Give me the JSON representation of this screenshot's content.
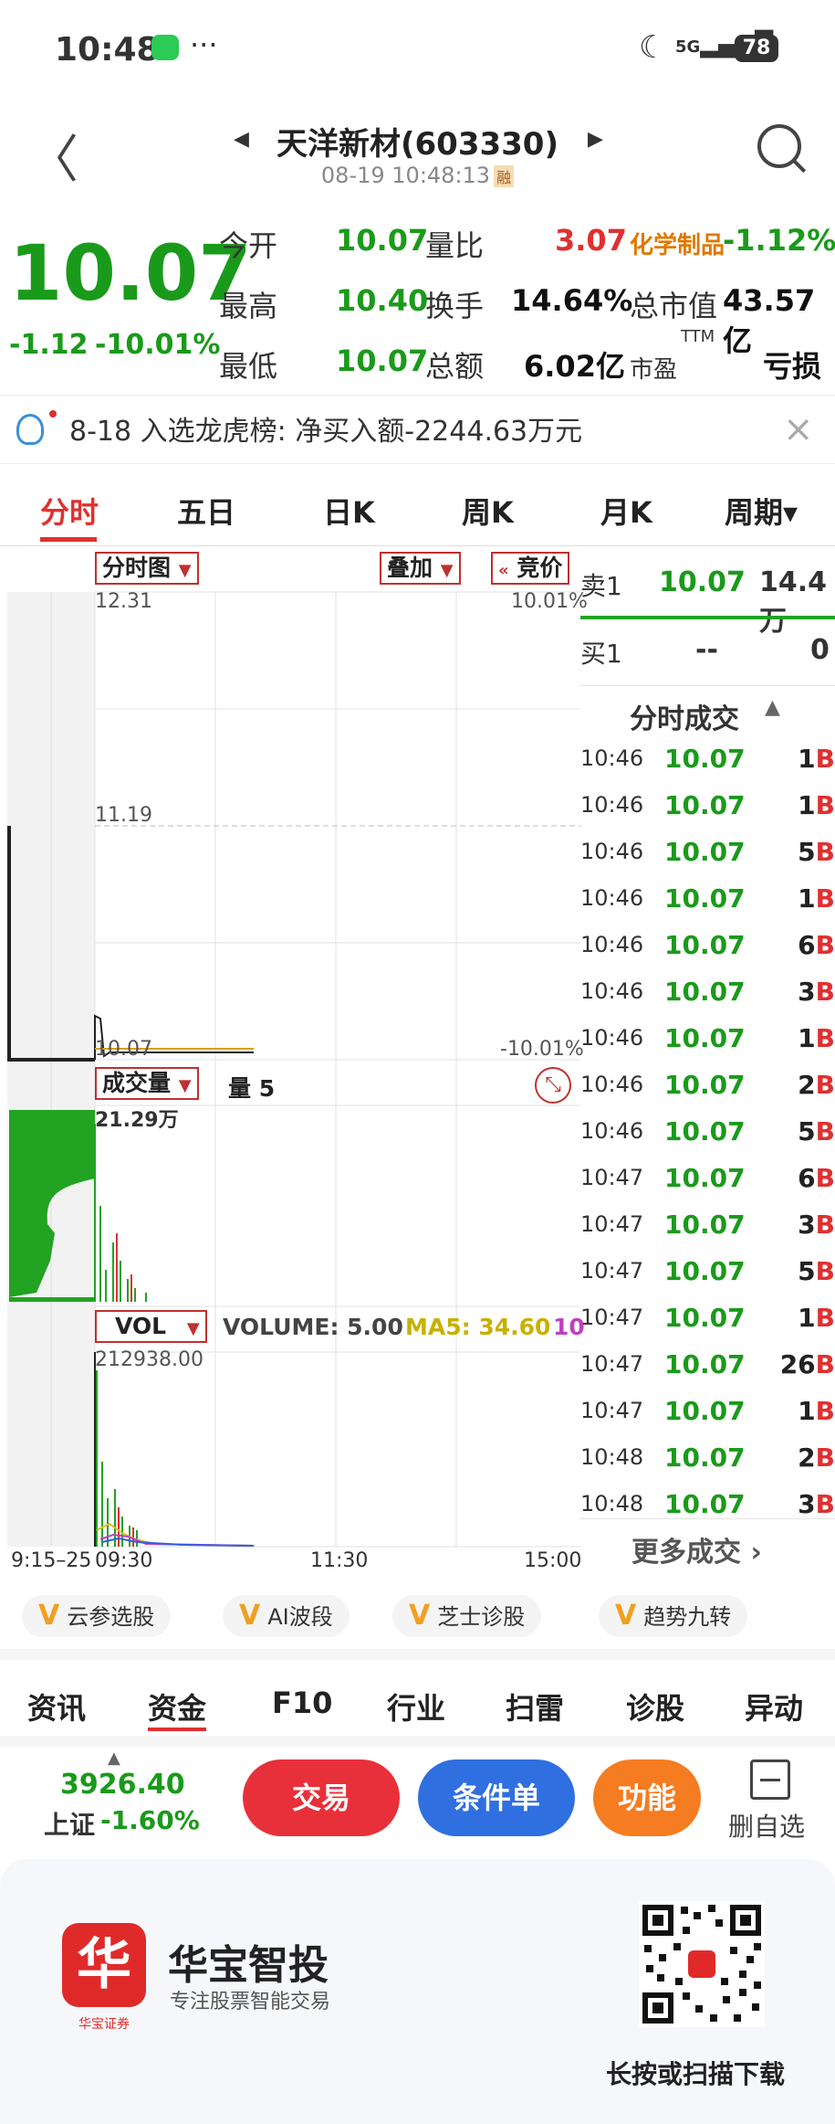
{
  "status": {
    "time": "10:48",
    "dots": "···",
    "signal": "5G",
    "battery": "78"
  },
  "header": {
    "title": "天洋新材(603330)",
    "subtitle": "08-19 10:48:13",
    "badge": "融"
  },
  "quote": {
    "price": "10.07",
    "change": "-1.12",
    "change_pct": "-10.01%",
    "open_label": "今开",
    "open": "10.07",
    "vol_ratio_label": "量比",
    "vol_ratio": "3.07",
    "sector": "化学制品",
    "sector_pct": "-1.12%",
    "high_label": "最高",
    "high": "10.40",
    "turnover_label": "换手",
    "turnover": "14.64%",
    "mcap_label": "总市值",
    "mcap": "43.57亿",
    "low_label": "最低",
    "low": "10.07",
    "amount_label": "总额",
    "amount": "6.02亿",
    "pe_label": "市盈",
    "pe_sup": "TTM",
    "pe": "亏损"
  },
  "notice": {
    "text": "8-18 入选龙虎榜: 净买入额-2244.63万元",
    "close": "×"
  },
  "tabs": [
    "分时",
    "五日",
    "日K",
    "周K",
    "月K",
    "周期▾"
  ],
  "chart": {
    "ctl_chart": "分时图",
    "ctl_overlay": "叠加",
    "ctl_auction": "竞价",
    "top_price": "12.31",
    "top_pct": "10.01%",
    "mid_price": "11.19",
    "low_price": "10.07",
    "low_pct": "-10.01%",
    "vol_ctl": "成交量",
    "vol_label": "量 5",
    "vol_max": "21.29万",
    "ind_ctl": "VOL",
    "ind_volume": "VOLUME: 5.00",
    "ind_ma5": "MA5: 34.60",
    "ind_ma10": "10",
    "ind_max": "212938.00",
    "x_labels": [
      "9:15–25",
      "09:30",
      "11:30",
      "15:00"
    ]
  },
  "book": {
    "sell1_label": "卖1",
    "sell1_price": "10.07",
    "sell1_vol": "14.4万",
    "buy1_label": "买1",
    "buy1_price": "--",
    "buy1_vol": "0",
    "trades_title": "分时成交",
    "trades": [
      [
        "10:46",
        "10.07",
        "1"
      ],
      [
        "10:46",
        "10.07",
        "1"
      ],
      [
        "10:46",
        "10.07",
        "5"
      ],
      [
        "10:46",
        "10.07",
        "1"
      ],
      [
        "10:46",
        "10.07",
        "6"
      ],
      [
        "10:46",
        "10.07",
        "3"
      ],
      [
        "10:46",
        "10.07",
        "1"
      ],
      [
        "10:46",
        "10.07",
        "2"
      ],
      [
        "10:46",
        "10.07",
        "5"
      ],
      [
        "10:47",
        "10.07",
        "6"
      ],
      [
        "10:47",
        "10.07",
        "3"
      ],
      [
        "10:47",
        "10.07",
        "5"
      ],
      [
        "10:47",
        "10.07",
        "1"
      ],
      [
        "10:47",
        "10.07",
        "26"
      ],
      [
        "10:47",
        "10.07",
        "1"
      ],
      [
        "10:48",
        "10.07",
        "2"
      ],
      [
        "10:48",
        "10.07",
        "3"
      ]
    ],
    "trade_flag": "B",
    "more": "更多成交 ›"
  },
  "vchips": [
    "云参选股",
    "AI波段",
    "芝士诊股",
    "趋势九转"
  ],
  "subtabs": [
    "资讯",
    "资金",
    "F10",
    "行业",
    "扫雷",
    "诊股",
    "异动"
  ],
  "bottom": {
    "index_value": "3926.40",
    "index_name": "上证",
    "index_pct": "-1.60%",
    "trade": "交易",
    "condition": "条件单",
    "func": "功能",
    "remove": "删自选"
  },
  "promo": {
    "brand": "华宝智投",
    "slogan": "专注股票智能交易",
    "logo_sub": "华宝证券",
    "qr_text": "长按或扫描下载"
  }
}
